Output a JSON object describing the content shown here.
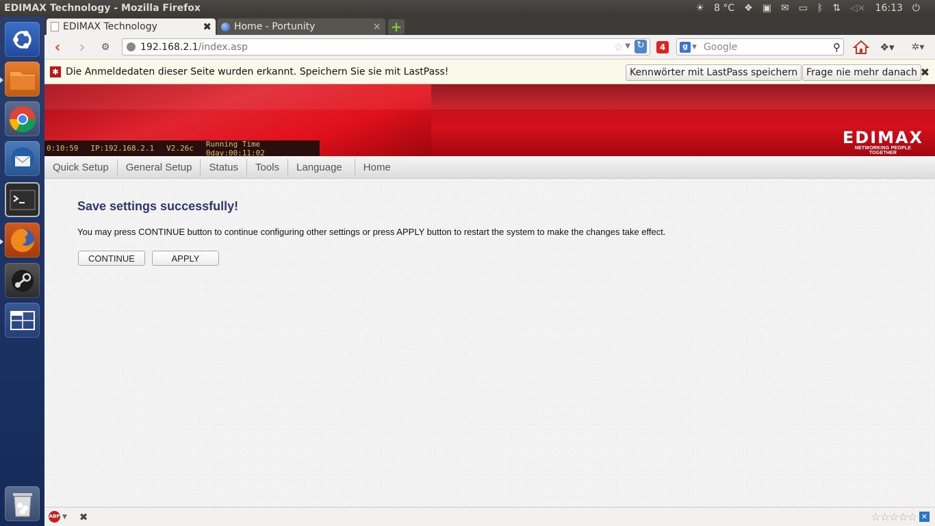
{
  "panel": {
    "window_title": "EDIMAX Technology - Mozilla Firefox",
    "weather": "8 °C",
    "clock": "16:13"
  },
  "launcher": {
    "items": [
      "ubuntu-dash",
      "files",
      "chrome",
      "thunderbird",
      "terminal",
      "firefox",
      "steam",
      "workspace-switcher",
      "trash"
    ]
  },
  "tabs": [
    {
      "label": "EDIMAX Technology",
      "active": true
    },
    {
      "label": "Home - Portunity",
      "active": false
    }
  ],
  "urlbar": {
    "host": "192.168.2.1",
    "path": "/index.asp"
  },
  "search": {
    "placeholder": "Google"
  },
  "badge_count": "4",
  "lastpass": {
    "message": "Die Anmeldedaten dieser Seite wurden erkannt. Speichern Sie sie mit LastPass!",
    "save_button": "Kennwörter mit LastPass speichern",
    "never_button": "Frage nie mehr danach"
  },
  "router": {
    "time": "0:10:59",
    "ip": "IP:192.168.2.1",
    "version": "V2.26c",
    "running": "Running Time 0day:00:11:02",
    "logo": "EDIMAX",
    "tagline": "NETWORKING PEOPLE TOGETHER",
    "menu": [
      "Quick Setup",
      "General Setup",
      "Status",
      "Tools",
      "Language",
      "Home"
    ],
    "title": "Save settings successfully!",
    "text": "You may press CONTINUE button to continue configuring other settings or press APPLY button to restart the system to make the changes take effect.",
    "continue_label": "CONTINUE",
    "apply_label": "APPLY"
  },
  "colors": {
    "accent_red": "#d3101b",
    "title_blue": "#2e3570",
    "launcher_bg": "#1e3567"
  }
}
